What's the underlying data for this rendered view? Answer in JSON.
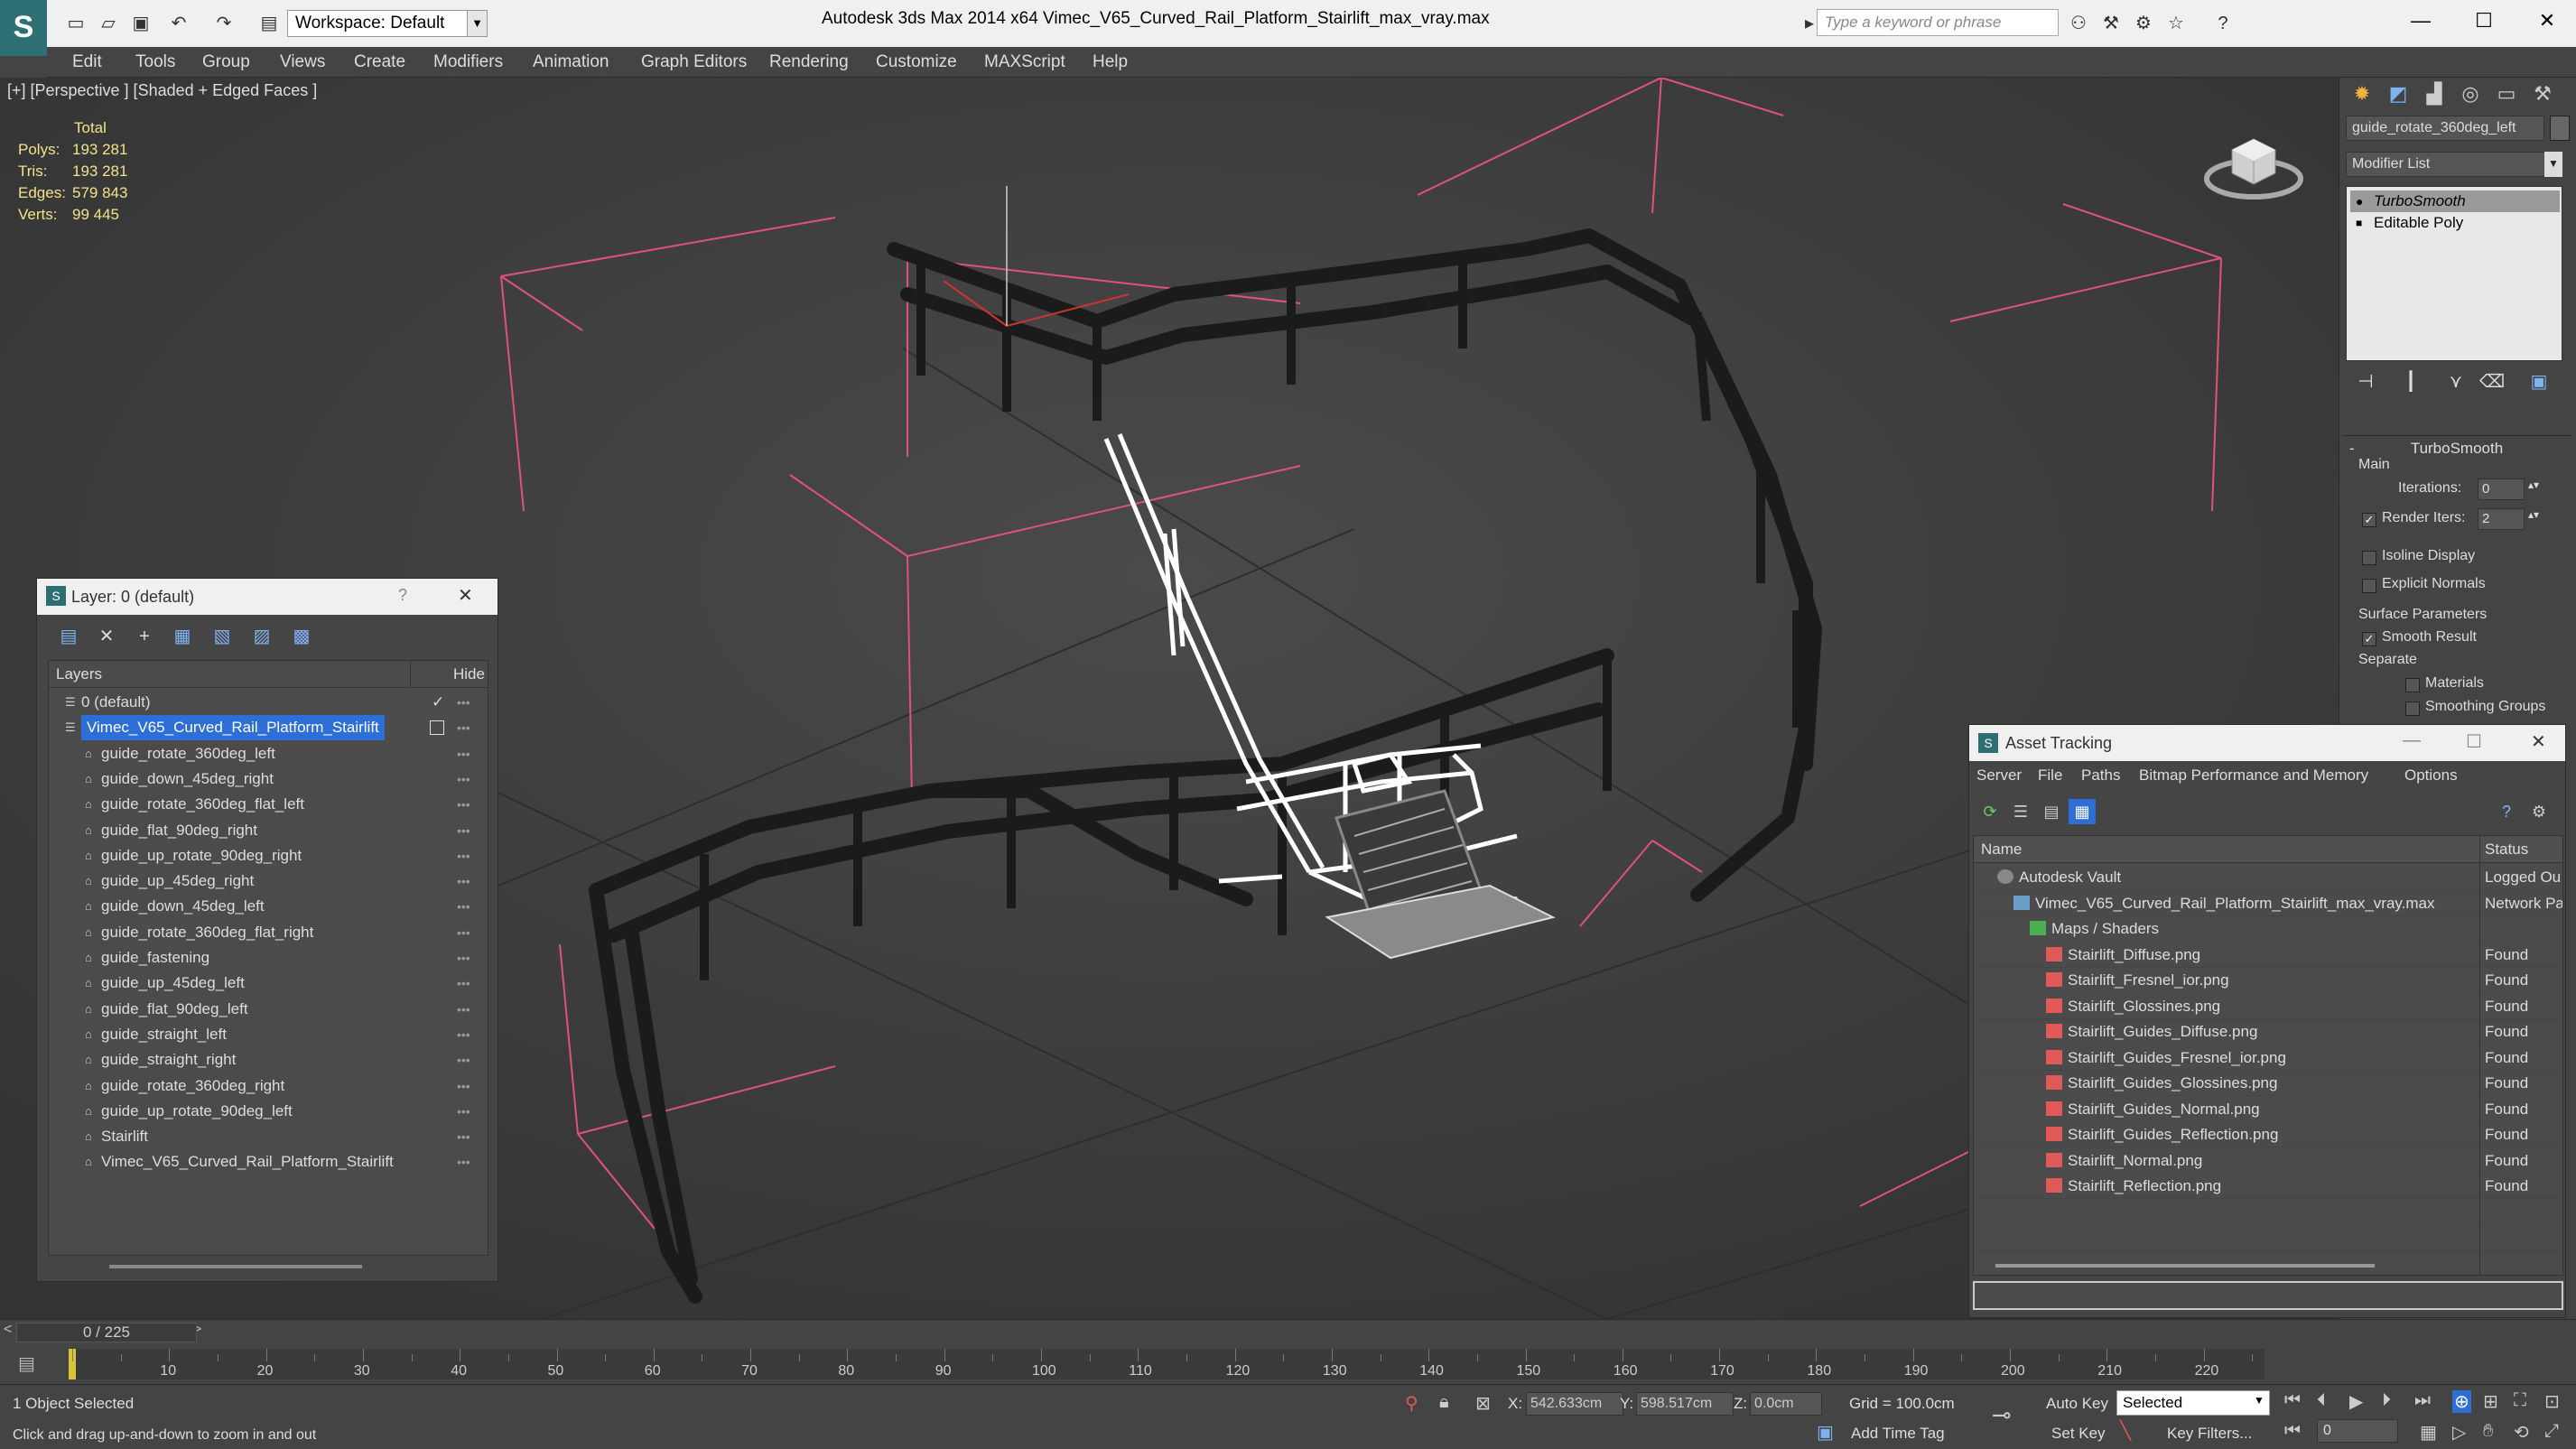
{
  "app": {
    "title": "Autodesk 3ds Max  2014 x64     Vimec_V65_Curved_Rail_Platform_Stairlift_max_vray.max",
    "logo": "S",
    "workspace": "Workspace: Default",
    "search_placeholder": "Type a keyword or phrase"
  },
  "menu": [
    "Edit",
    "Tools",
    "Group",
    "Views",
    "Create",
    "Modifiers",
    "Animation",
    "Graph Editors",
    "Rendering",
    "Customize",
    "MAXScript",
    "Help"
  ],
  "viewport": {
    "label": "[+] [Perspective ] [Shaded + Edged Faces ]",
    "stats": {
      "header": "Total",
      "rows": [
        {
          "label": "Polys:",
          "value": "193 281"
        },
        {
          "label": "Tris:",
          "value": "193 281"
        },
        {
          "label": "Edges:",
          "value": "579 843"
        },
        {
          "label": "Verts:",
          "value": "99 445"
        }
      ]
    }
  },
  "layer_panel": {
    "title": "Layer: 0 (default)",
    "help": "?",
    "close": "✕",
    "col_layers": "Layers",
    "col_hide": "Hide",
    "rows": [
      {
        "name": "0 (default)",
        "indent": 1,
        "check": "✓"
      },
      {
        "name": "Vimec_V65_Curved_Rail_Platform_Stairlift",
        "indent": 1,
        "selected": true
      },
      {
        "name": "guide_rotate_360deg_left",
        "indent": 2
      },
      {
        "name": "guide_down_45deg_right",
        "indent": 2
      },
      {
        "name": "guide_rotate_360deg_flat_left",
        "indent": 2
      },
      {
        "name": "guide_flat_90deg_right",
        "indent": 2
      },
      {
        "name": "guide_up_rotate_90deg_right",
        "indent": 2
      },
      {
        "name": "guide_up_45deg_right",
        "indent": 2
      },
      {
        "name": "guide_down_45deg_left",
        "indent": 2
      },
      {
        "name": "guide_rotate_360deg_flat_right",
        "indent": 2
      },
      {
        "name": "guide_fastening",
        "indent": 2
      },
      {
        "name": "guide_up_45deg_left",
        "indent": 2
      },
      {
        "name": "guide_flat_90deg_left",
        "indent": 2
      },
      {
        "name": "guide_straight_left",
        "indent": 2
      },
      {
        "name": "guide_straight_right",
        "indent": 2
      },
      {
        "name": "guide_rotate_360deg_right",
        "indent": 2
      },
      {
        "name": "guide_up_rotate_90deg_left",
        "indent": 2
      },
      {
        "name": "Stairlift",
        "indent": 2
      },
      {
        "name": "Vimec_V65_Curved_Rail_Platform_Stairlift",
        "indent": 2
      }
    ]
  },
  "command_panel": {
    "object_name": "guide_rotate_360deg_left",
    "modifier_list": "Modifier List",
    "stack": [
      "TurboSmooth",
      "Editable Poly"
    ],
    "rollout": "TurboSmooth",
    "main": "Main",
    "iterations_label": "Iterations:",
    "iterations": "0",
    "render_iters_label": "Render Iters:",
    "render_iters": "2",
    "isoline": "Isoline Display",
    "explicit": "Explicit Normals",
    "surface": "Surface Parameters",
    "smooth_result": "Smooth Result",
    "separate": "Separate",
    "materials": "Materials",
    "smoothing_groups": "Smoothing Groups"
  },
  "asset_tracking": {
    "title": "Asset Tracking",
    "menu": [
      "Server",
      "File",
      "Paths",
      "Bitmap Performance and Memory",
      "Options"
    ],
    "col_name": "Name",
    "col_status": "Status",
    "rows": [
      {
        "name": "Autodesk Vault",
        "status": "Logged Ou",
        "indent": 1,
        "icon": "vault"
      },
      {
        "name": "Vimec_V65_Curved_Rail_Platform_Stairlift_max_vray.max",
        "status": "Network Pa",
        "indent": 2,
        "icon": "max"
      },
      {
        "name": "Maps / Shaders",
        "status": "",
        "indent": 3,
        "icon": "maps"
      },
      {
        "name": "Stairlift_Diffuse.png",
        "status": "Found",
        "indent": 4,
        "icon": "png"
      },
      {
        "name": "Stairlift_Fresnel_ior.png",
        "status": "Found",
        "indent": 4,
        "icon": "png"
      },
      {
        "name": "Stairlift_Glossines.png",
        "status": "Found",
        "indent": 4,
        "icon": "png"
      },
      {
        "name": "Stairlift_Guides_Diffuse.png",
        "status": "Found",
        "indent": 4,
        "icon": "png"
      },
      {
        "name": "Stairlift_Guides_Fresnel_ior.png",
        "status": "Found",
        "indent": 4,
        "icon": "png"
      },
      {
        "name": "Stairlift_Guides_Glossines.png",
        "status": "Found",
        "indent": 4,
        "icon": "png"
      },
      {
        "name": "Stairlift_Guides_Normal.png",
        "status": "Found",
        "indent": 4,
        "icon": "png"
      },
      {
        "name": "Stairlift_Guides_Reflection.png",
        "status": "Found",
        "indent": 4,
        "icon": "png"
      },
      {
        "name": "Stairlift_Normal.png",
        "status": "Found",
        "indent": 4,
        "icon": "png"
      },
      {
        "name": "Stairlift_Reflection.png",
        "status": "Found",
        "indent": 4,
        "icon": "png"
      }
    ]
  },
  "timeline": {
    "position": "0 / 225",
    "ticks": [
      "10",
      "20",
      "30",
      "40",
      "50",
      "60",
      "70",
      "80",
      "90",
      "100",
      "110",
      "120",
      "130",
      "140",
      "150",
      "160",
      "170",
      "180",
      "190",
      "200",
      "210",
      "220"
    ]
  },
  "status": {
    "selection": "1 Object Selected",
    "prompt": "Click and drag up-and-down to zoom in and out",
    "x_label": "X:",
    "x": "542.633cm",
    "y_label": "Y:",
    "y": "598.517cm",
    "z_label": "Z:",
    "z": "0.0cm",
    "grid": "Grid = 100.0cm",
    "auto_key": "Auto Key",
    "set_key": "Set Key",
    "selected": "Selected",
    "key_filters": "Key Filters...",
    "add_time_tag": "Add Time Tag",
    "frame": "0"
  },
  "colors": {
    "selection_blue": "#2d6fd6",
    "wire_pink": "#e0527a",
    "stats_yellow": "#f2e28a"
  }
}
